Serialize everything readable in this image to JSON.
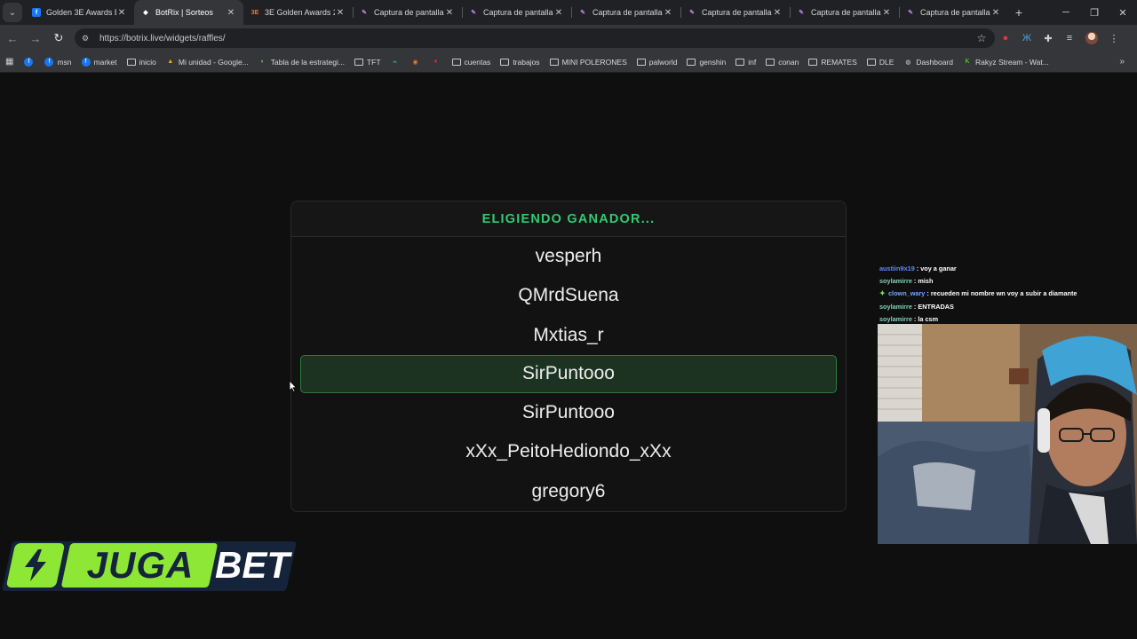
{
  "browser": {
    "tabs": [
      {
        "title": "Golden 3E Awards Es",
        "icon": "facebook-icon",
        "color": "#1877f2",
        "glyph": "f",
        "active": false
      },
      {
        "title": "BotRix | Sorteos",
        "icon": "botrix-icon",
        "color": "#ffffff",
        "glyph": "◆",
        "active": true
      },
      {
        "title": "3E Golden Awards 20",
        "icon": "3e-icon",
        "color": "#ff7a1a",
        "glyph": "3E",
        "active": false
      },
      {
        "title": "Captura de pantalla p",
        "icon": "snipping-tool-icon",
        "color": "#b678e0",
        "glyph": "✎",
        "active": false
      },
      {
        "title": "Captura de pantalla p",
        "icon": "snipping-tool-icon",
        "color": "#b678e0",
        "glyph": "✎",
        "active": false
      },
      {
        "title": "Captura de pantalla p",
        "icon": "snipping-tool-icon",
        "color": "#b678e0",
        "glyph": "✎",
        "active": false
      },
      {
        "title": "Captura de pantalla p",
        "icon": "snipping-tool-icon",
        "color": "#b678e0",
        "glyph": "✎",
        "active": false
      },
      {
        "title": "Captura de pantalla p",
        "icon": "snipping-tool-icon",
        "color": "#b678e0",
        "glyph": "✎",
        "active": false
      },
      {
        "title": "Captura de pantalla p",
        "icon": "snipping-tool-icon",
        "color": "#b678e0",
        "glyph": "✎",
        "active": false
      }
    ],
    "url": "https://botrix.live/widgets/raffles/",
    "bookmarks": [
      {
        "label": "",
        "kind": "icon",
        "icon": "facebook-icon",
        "color": "#1877f2",
        "glyph": "f"
      },
      {
        "label": "msn",
        "kind": "icon",
        "icon": "facebook-icon",
        "color": "#1877f2",
        "glyph": "f"
      },
      {
        "label": "market",
        "kind": "icon",
        "icon": "facebook-icon",
        "color": "#1877f2",
        "glyph": "f"
      },
      {
        "label": "inicio",
        "kind": "folder"
      },
      {
        "label": "Mi unidad - Google...",
        "kind": "icon",
        "icon": "google-drive-icon",
        "color": "#f4b400",
        "glyph": "▲"
      },
      {
        "label": "Tabla de la estrategi...",
        "kind": "icon",
        "icon": "sheet-icon",
        "color": "#7cc242",
        "glyph": "◐"
      },
      {
        "label": "TFT",
        "kind": "folder"
      },
      {
        "label": "",
        "kind": "icon",
        "icon": "leaf-icon",
        "color": "#2aa46a",
        "glyph": "❧"
      },
      {
        "label": "",
        "kind": "icon",
        "icon": "crunchyroll-icon",
        "color": "#f47521",
        "glyph": "◉"
      },
      {
        "label": "",
        "kind": "icon",
        "icon": "red-icon",
        "color": "#d93025",
        "glyph": "♦"
      },
      {
        "label": "cuentas",
        "kind": "folder"
      },
      {
        "label": "trabajos",
        "kind": "folder"
      },
      {
        "label": "MINI POLERONES",
        "kind": "folder"
      },
      {
        "label": "palworld",
        "kind": "folder"
      },
      {
        "label": "genshin",
        "kind": "folder"
      },
      {
        "label": "inf",
        "kind": "folder"
      },
      {
        "label": "conan",
        "kind": "folder"
      },
      {
        "label": "REMATES",
        "kind": "folder"
      },
      {
        "label": "DLE",
        "kind": "folder"
      },
      {
        "label": "Dashboard",
        "kind": "icon",
        "icon": "dashboard-icon",
        "color": "#cfcfcf",
        "glyph": "◍"
      },
      {
        "label": "Rakyz Stream - Wat...",
        "kind": "icon",
        "icon": "kick-icon",
        "color": "#53fc18",
        "glyph": "K"
      }
    ]
  },
  "raffle": {
    "header": "ELIGIENDO GANADOR...",
    "accent": "#2ecc71",
    "entries": [
      "vesperh",
      "QMrdSuena",
      "Mxtias_r",
      "SirPuntooo",
      "SirPuntooo",
      "xXx_PeitoHediondo_xXx",
      "gregory6"
    ],
    "highlighted_index": 3
  },
  "chat": [
    {
      "user": "austiin9x19",
      "color": "#5b8cff",
      "message": ": voy a ganar",
      "badge": false
    },
    {
      "user": "soylamirre",
      "color": "#7fd3b8",
      "message": ": mish",
      "badge": false
    },
    {
      "user": "clown_wary",
      "color": "#6fa8ff",
      "message": ": recueden mi nombre wn voy a subir a diamante",
      "badge": true
    },
    {
      "user": "soylamirre",
      "color": "#7fd3b8",
      "message": ": ENTRADAS",
      "badge": false
    },
    {
      "user": "soylamirre",
      "color": "#7fd3b8",
      "message": ": la csm",
      "badge": false
    }
  ],
  "logo": {
    "part1": "JUGA",
    "part2": "BET",
    "green": "#8ee635",
    "navy": "#15243a"
  }
}
